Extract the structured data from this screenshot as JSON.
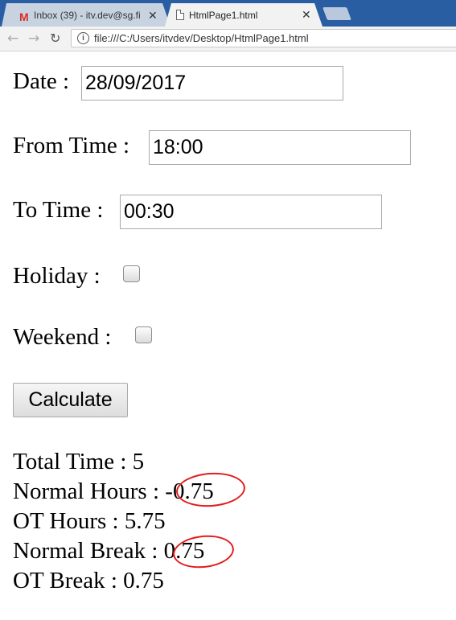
{
  "browser": {
    "tabs": [
      {
        "title": "Inbox (39) - itv.dev@sg.fi",
        "icon": "gmail-icon",
        "active": false
      },
      {
        "title": "HtmlPage1.html",
        "icon": "page-icon",
        "active": true
      }
    ],
    "close_glyph": "✕",
    "url": "file:///C:/Users/itvdev/Desktop/HtmlPage1.html",
    "gmail_letter": "M",
    "info_glyph": "i"
  },
  "form": {
    "date_label": "Date :",
    "date_value": "28/09/2017",
    "from_label": "From Time :",
    "from_value": "18:00",
    "to_label": "To Time :",
    "to_value": "00:30",
    "holiday_label": "Holiday :",
    "holiday_checked": false,
    "weekend_label": "Weekend :",
    "weekend_checked": false,
    "calculate_label": "Calculate"
  },
  "results": {
    "total_time": "Total Time : 5",
    "normal_hours_label": "Normal Hours :",
    "normal_hours_value": "-0.75",
    "ot_hours": "OT Hours : 5.75",
    "normal_break_label": "Normal Break :",
    "normal_break_value": "0.75",
    "ot_break": "OT Break : 0.75"
  },
  "annotation_color": "#e31c1c"
}
